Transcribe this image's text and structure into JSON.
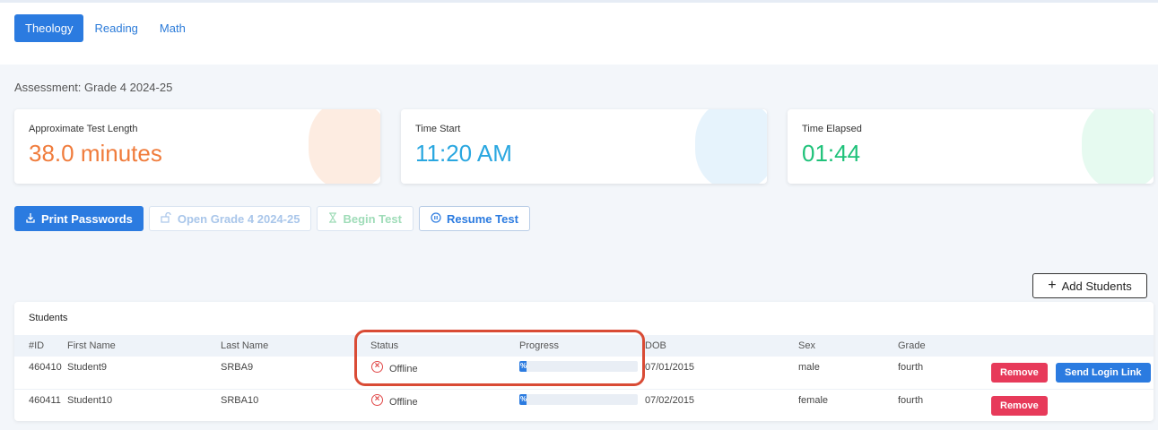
{
  "tabs": [
    {
      "label": "Theology",
      "active": true
    },
    {
      "label": "Reading",
      "active": false
    },
    {
      "label": "Math",
      "active": false
    }
  ],
  "assessment_label": "Assessment: Grade 4 2024-25",
  "cards": [
    {
      "label": "Approximate Test Length",
      "value": "38.0 minutes",
      "color": "#f07c3c"
    },
    {
      "label": "Time Start",
      "value": "11:20 AM",
      "color": "#2aa7e0"
    },
    {
      "label": "Time Elapsed",
      "value": "01:44",
      "color": "#1fc27a"
    }
  ],
  "buttons": {
    "print_passwords": "Print Passwords",
    "open_test": "Open Grade 4 2024-25",
    "begin_test": "Begin Test",
    "resume_test": "Resume Test",
    "add_students": "Add Students"
  },
  "students": {
    "title": "Students",
    "columns": [
      "#ID",
      "First Name",
      "Last Name",
      "Status",
      "Progress",
      "DOB",
      "Sex",
      "Grade"
    ],
    "rows": [
      {
        "id": "460410",
        "first": "Student9",
        "last": "SRBA9",
        "status": "Offline",
        "progress": "%",
        "progress_fraction": 0.06,
        "dob": "07/01/2015",
        "sex": "male",
        "grade": "fourth"
      },
      {
        "id": "460411",
        "first": "Student10",
        "last": "SRBA10",
        "status": "Offline",
        "progress": "%",
        "progress_fraction": 0.06,
        "dob": "07/02/2015",
        "sex": "female",
        "grade": "fourth"
      }
    ],
    "remove_label": "Remove",
    "send_login_label": "Send Login Link"
  },
  "colors": {
    "primary": "#2b7be0",
    "danger": "#e73a5a",
    "highlight": "#d94b35"
  }
}
